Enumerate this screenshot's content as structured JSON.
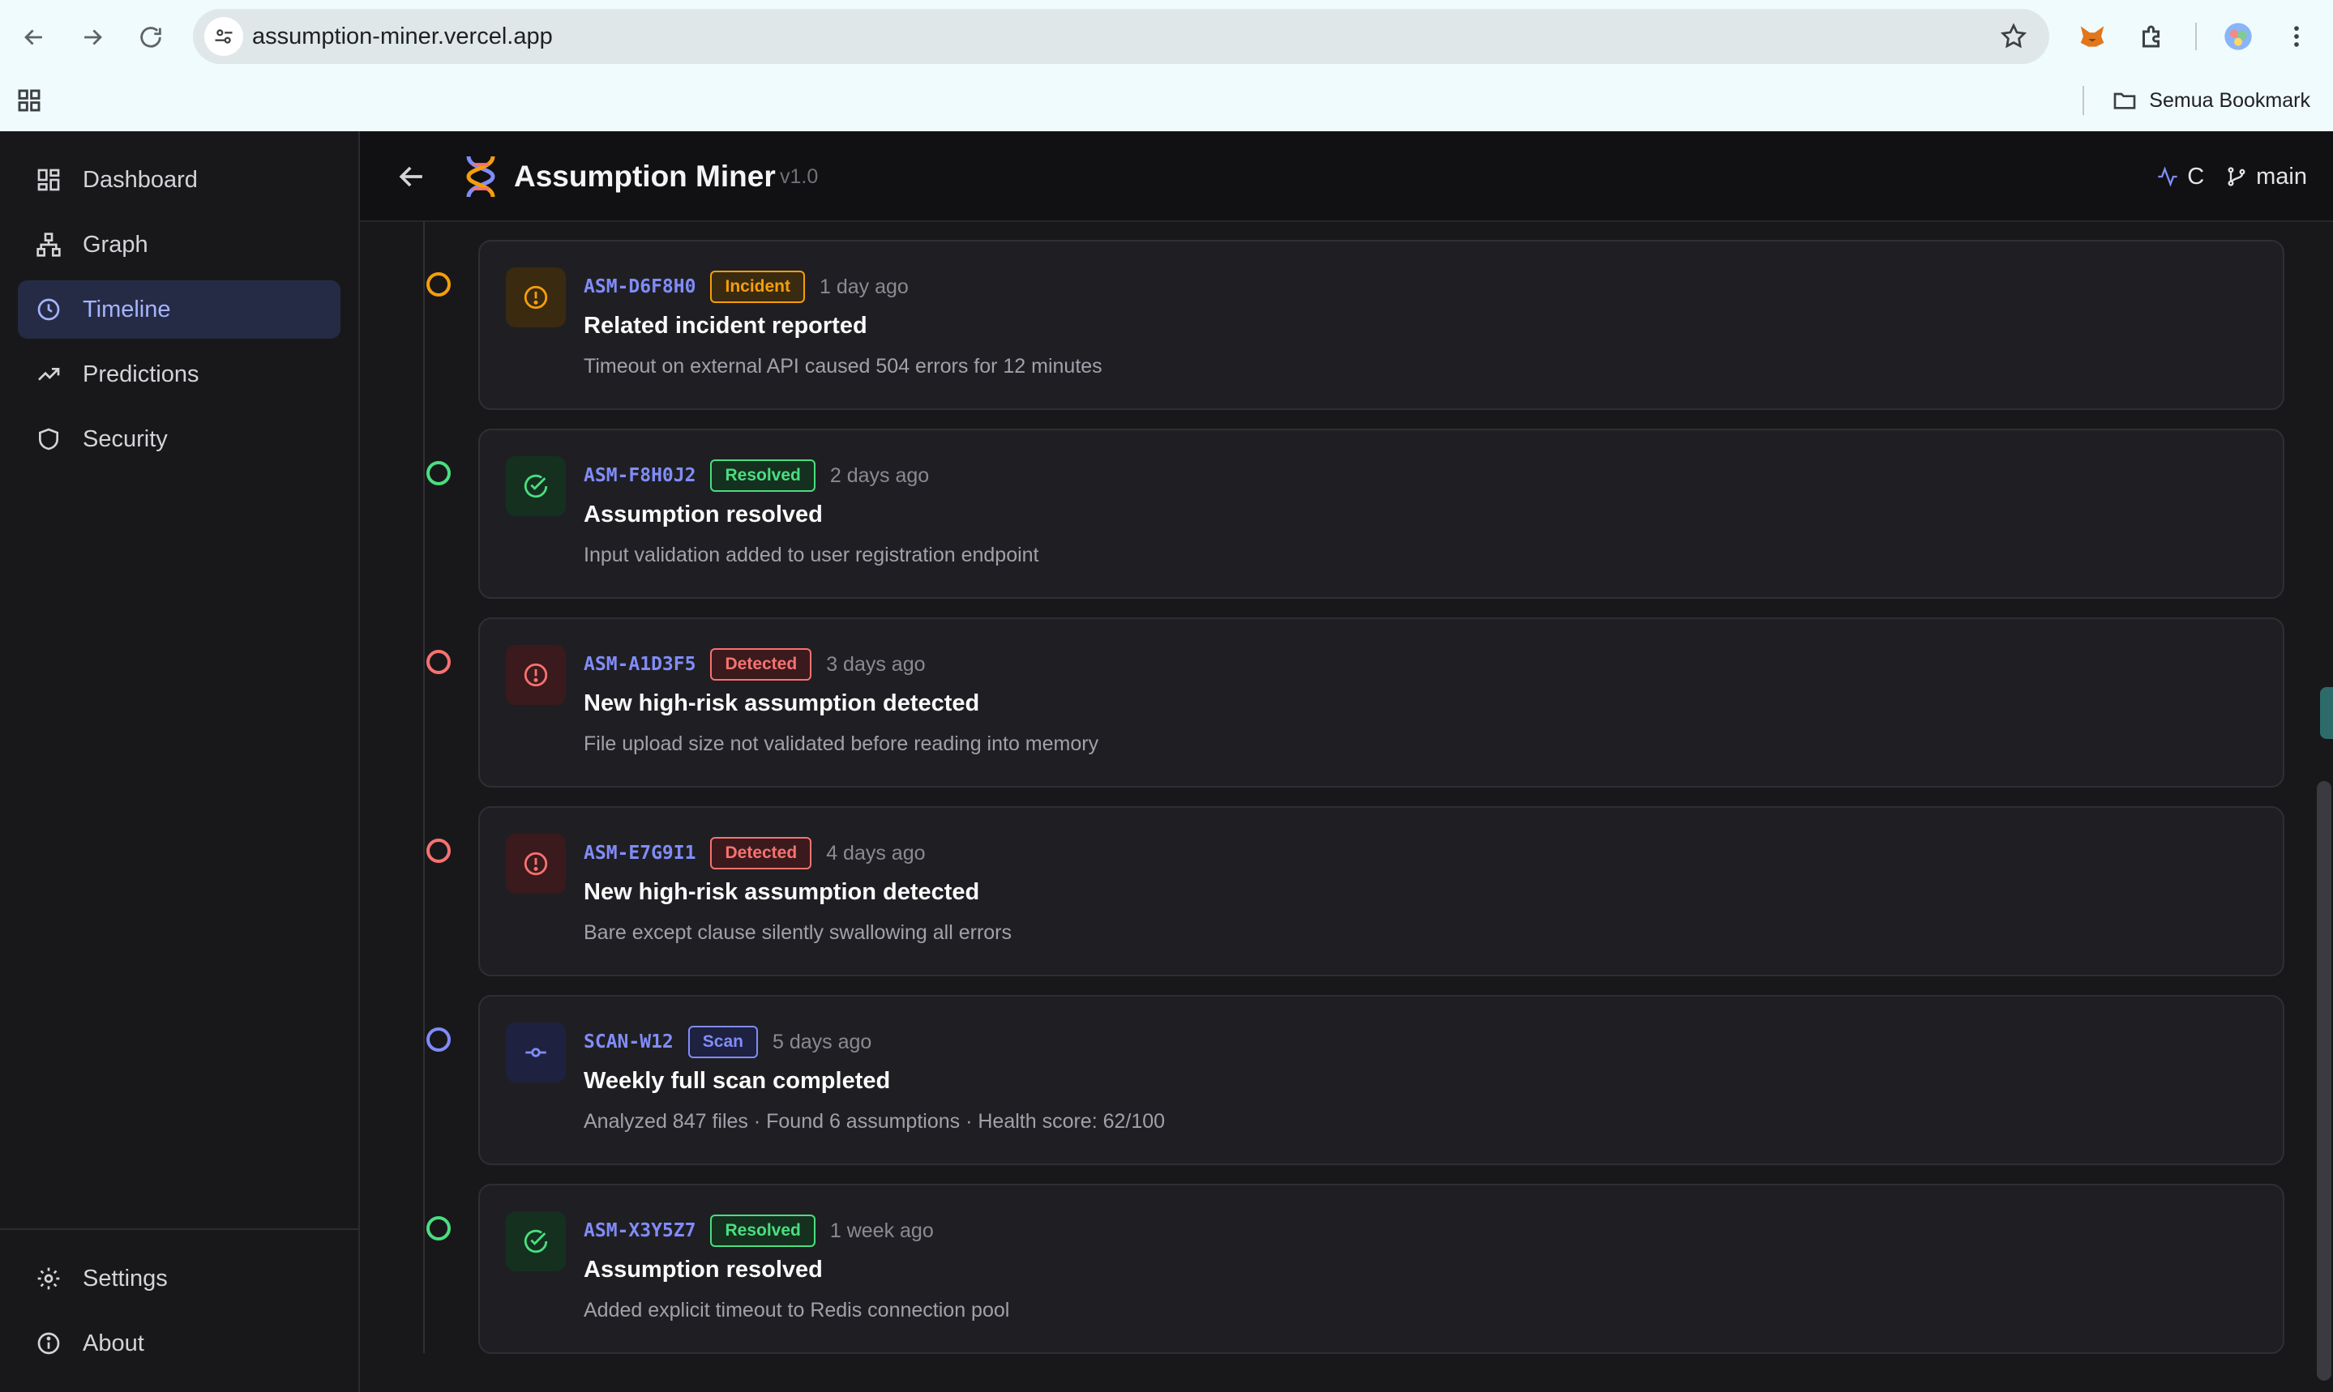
{
  "browser": {
    "url": "assumption-miner.vercel.app",
    "bookmark_label": "Semua Bookmark"
  },
  "sidebar": {
    "items": [
      {
        "label": "Dashboard",
        "icon": "dashboard-icon"
      },
      {
        "label": "Graph",
        "icon": "graph-icon"
      },
      {
        "label": "Timeline",
        "icon": "clock-icon",
        "active": true
      },
      {
        "label": "Predictions",
        "icon": "trending-up-icon"
      },
      {
        "label": "Security",
        "icon": "shield-icon"
      }
    ],
    "bottom_items": [
      {
        "label": "Settings",
        "icon": "gear-icon"
      },
      {
        "label": "About",
        "icon": "info-icon"
      }
    ]
  },
  "header": {
    "title": "Assumption Miner",
    "version": "v1.0",
    "activity_label": "C",
    "branch_label": "main"
  },
  "timeline": {
    "events": [
      {
        "id": "ASM-D6F8H0",
        "badge": "Incident",
        "time": "1 day ago",
        "title": "Related incident reported",
        "description": "Timeout on external API caused 504 errors for 12 minutes",
        "kind": "incident"
      },
      {
        "id": "ASM-F8H0J2",
        "badge": "Resolved",
        "time": "2 days ago",
        "title": "Assumption resolved",
        "description": "Input validation added to user registration endpoint",
        "kind": "resolved"
      },
      {
        "id": "ASM-A1D3F5",
        "badge": "Detected",
        "time": "3 days ago",
        "title": "New high-risk assumption detected",
        "description": "File upload size not validated before reading into memory",
        "kind": "detected"
      },
      {
        "id": "ASM-E7G9I1",
        "badge": "Detected",
        "time": "4 days ago",
        "title": "New high-risk assumption detected",
        "description": "Bare except clause silently swallowing all errors",
        "kind": "detected"
      },
      {
        "id": "SCAN-W12",
        "badge": "Scan",
        "time": "5 days ago",
        "title": "Weekly full scan completed",
        "description": "Analyzed 847 files · Found 6 assumptions · Health score: 62/100",
        "kind": "scan"
      },
      {
        "id": "ASM-X3Y5Z7",
        "badge": "Resolved",
        "time": "1 week ago",
        "title": "Assumption resolved",
        "description": "Added explicit timeout to Redis connection pool",
        "kind": "resolved"
      }
    ]
  },
  "colors": {
    "incident": "#f59e0b",
    "resolved": "#4ade80",
    "detected": "#f87171",
    "scan": "#818cf8",
    "accent": "#a5b4fc"
  }
}
